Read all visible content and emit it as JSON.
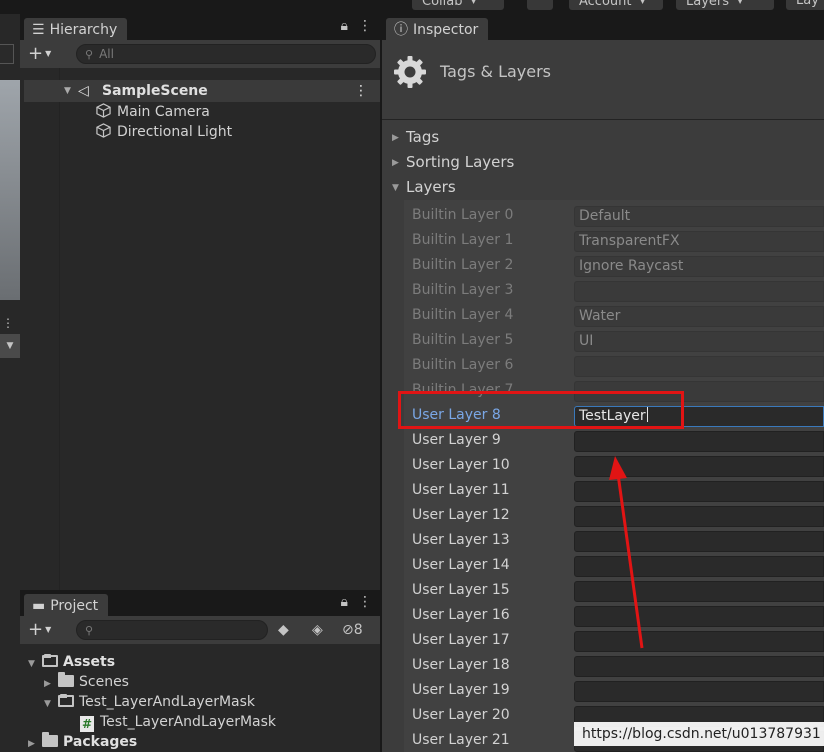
{
  "toolbar": {
    "collab": "Collab",
    "account": "Account",
    "layers": "Layers",
    "layout": "Lay"
  },
  "hierarchy": {
    "tab": "Hierarchy",
    "search_placeholder": "All",
    "scene": "SampleScene",
    "objects": [
      "Main Camera",
      "Directional Light"
    ]
  },
  "project": {
    "tab": "Project",
    "hidden_count": "8",
    "tree": {
      "assets": "Assets",
      "scenes": "Scenes",
      "test_folder": "Test_LayerAndLayerMask",
      "test_script": "Test_LayerAndLayerMask",
      "packages": "Packages"
    }
  },
  "inspector": {
    "tab": "Inspector",
    "title": "Tags & Layers",
    "sections": {
      "tags": "Tags",
      "sorting_layers": "Sorting Layers",
      "layers": "Layers"
    },
    "layers": [
      {
        "name": "Builtin Layer 0",
        "value": "Default",
        "builtin": true
      },
      {
        "name": "Builtin Layer 1",
        "value": "TransparentFX",
        "builtin": true
      },
      {
        "name": "Builtin Layer 2",
        "value": "Ignore Raycast",
        "builtin": true
      },
      {
        "name": "Builtin Layer 3",
        "value": "",
        "builtin": true
      },
      {
        "name": "Builtin Layer 4",
        "value": "Water",
        "builtin": true
      },
      {
        "name": "Builtin Layer 5",
        "value": "UI",
        "builtin": true
      },
      {
        "name": "Builtin Layer 6",
        "value": "",
        "builtin": true
      },
      {
        "name": "Builtin Layer 7",
        "value": "",
        "builtin": true
      },
      {
        "name": "User Layer 8",
        "value": "TestLayer",
        "builtin": false,
        "active": true
      },
      {
        "name": "User Layer 9",
        "value": "",
        "builtin": false
      },
      {
        "name": "User Layer 10",
        "value": "",
        "builtin": false
      },
      {
        "name": "User Layer 11",
        "value": "",
        "builtin": false
      },
      {
        "name": "User Layer 12",
        "value": "",
        "builtin": false
      },
      {
        "name": "User Layer 13",
        "value": "",
        "builtin": false
      },
      {
        "name": "User Layer 14",
        "value": "",
        "builtin": false
      },
      {
        "name": "User Layer 15",
        "value": "",
        "builtin": false
      },
      {
        "name": "User Layer 16",
        "value": "",
        "builtin": false
      },
      {
        "name": "User Layer 17",
        "value": "",
        "builtin": false
      },
      {
        "name": "User Layer 18",
        "value": "",
        "builtin": false
      },
      {
        "name": "User Layer 19",
        "value": "",
        "builtin": false
      },
      {
        "name": "User Layer 20",
        "value": "",
        "builtin": false
      },
      {
        "name": "User Layer 21",
        "value": "",
        "builtin": false
      }
    ]
  },
  "watermark": "https://blog.csdn.net/u013787931",
  "colors": {
    "annotation": "#e11414",
    "active_label": "#7aa7e6",
    "focus_border": "#3a79bb"
  }
}
